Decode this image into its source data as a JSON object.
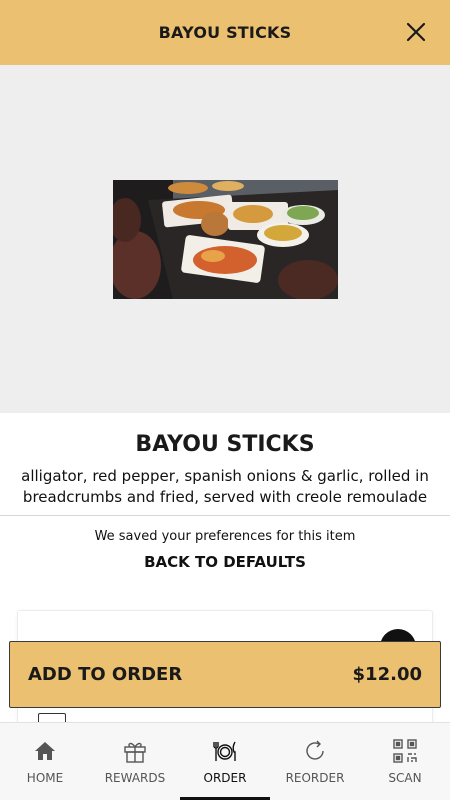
{
  "header": {
    "title": "BAYOU STICKS",
    "close_icon": "close-icon"
  },
  "item": {
    "image_alt": "Platters of food on a restaurant table",
    "title": "BAYOU STICKS",
    "description": "alligator, red pepper, spanish onions & garlic, rolled in breadcrumbs and fried, served with creole remoulade"
  },
  "preferences": {
    "note": "We saved your preferences for this item",
    "reset_label": "BACK TO DEFAULTS"
  },
  "add_to_order": {
    "label": "ADD TO ORDER",
    "price": "$12.00"
  },
  "tabs": [
    {
      "label": "HOME",
      "icon": "home-icon"
    },
    {
      "label": "REWARDS",
      "icon": "gift-icon"
    },
    {
      "label": "ORDER",
      "icon": "plate-cutlery-icon",
      "active": true
    },
    {
      "label": "REORDER",
      "icon": "refresh-icon"
    },
    {
      "label": "SCAN",
      "icon": "qr-code-icon"
    }
  ],
  "colors": {
    "accent": "#ebc070",
    "hero_bg": "#eeeeee",
    "text": "#1a1a1a"
  }
}
